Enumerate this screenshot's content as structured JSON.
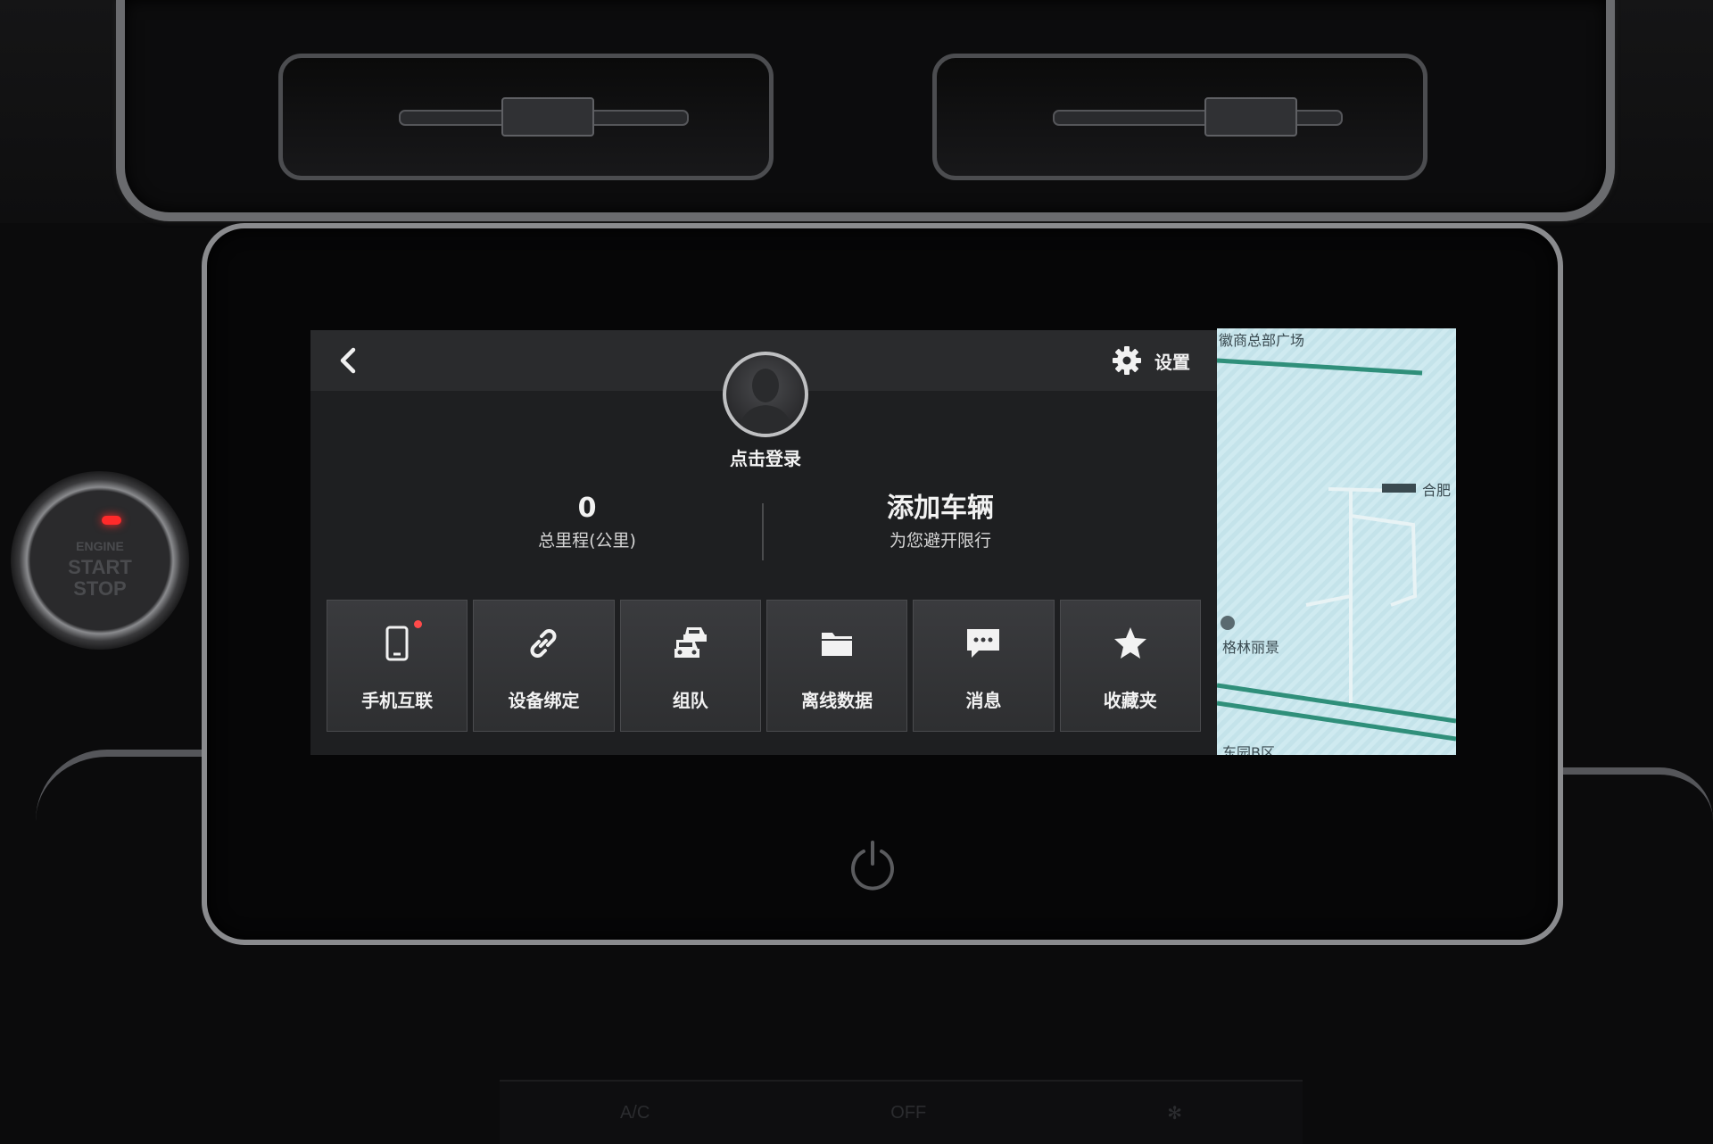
{
  "header": {
    "login_label": "点击登录",
    "settings_label": "设置"
  },
  "stats": {
    "mileage_value": "0",
    "mileage_label": "总里程(公里)",
    "vehicle_title": "添加车辆",
    "vehicle_subtitle": "为您避开限行"
  },
  "tiles": [
    {
      "label": "手机互联",
      "icon": "phone-icon"
    },
    {
      "label": "设备绑定",
      "icon": "link-icon"
    },
    {
      "label": "组队",
      "icon": "team-cars-icon"
    },
    {
      "label": "离线数据",
      "icon": "folder-icon"
    },
    {
      "label": "消息",
      "icon": "message-icon"
    },
    {
      "label": "收藏夹",
      "icon": "star-icon"
    }
  ],
  "map": {
    "labels": [
      "徽商总部广场",
      "合肥",
      "格林丽景",
      "东园B区"
    ]
  },
  "dashboard": {
    "start_button_text": [
      "ENGINE",
      "START",
      "STOP"
    ],
    "climate_labels": [
      "A/C",
      "OFF"
    ]
  },
  "colors": {
    "ui_background": "#1e1f21",
    "tile_background": "#3a3b3e",
    "notification_dot": "#ff4a4a",
    "map_road": "#2f8f7a",
    "map_background": "#cfeaf0"
  }
}
